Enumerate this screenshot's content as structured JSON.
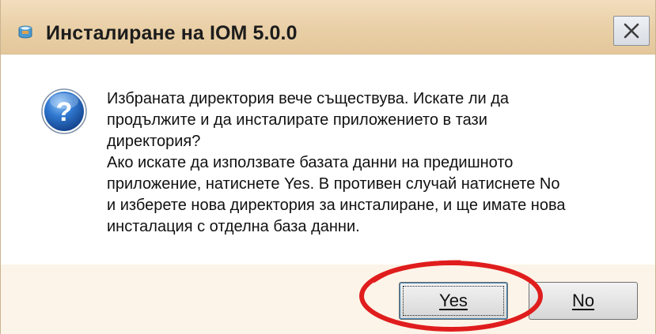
{
  "dialog": {
    "title": "Инсталиране на IOM 5.0.0",
    "close_label": "✕",
    "message_lines": [
      "Избраната директория вече съществува. Искате ли да",
      "продължите и да инсталирате приложението  в тази",
      "директория?",
      "Ако искате да използвате базата данни на предишното",
      "приложение, натиснете Yes. В противен случай натиснете No",
      "и изберете нова директория за инсталиране, и ще имате нова",
      "инсталация с отделна база данни."
    ],
    "icons": {
      "title": "installer-icon",
      "message": "question-icon"
    },
    "buttons": {
      "yes_label": "Yes",
      "no_label": "No"
    },
    "colors": {
      "titlebar": "#e9cfa6",
      "question_icon": "#2b6cc4",
      "annotation": "#e01d1d"
    }
  }
}
